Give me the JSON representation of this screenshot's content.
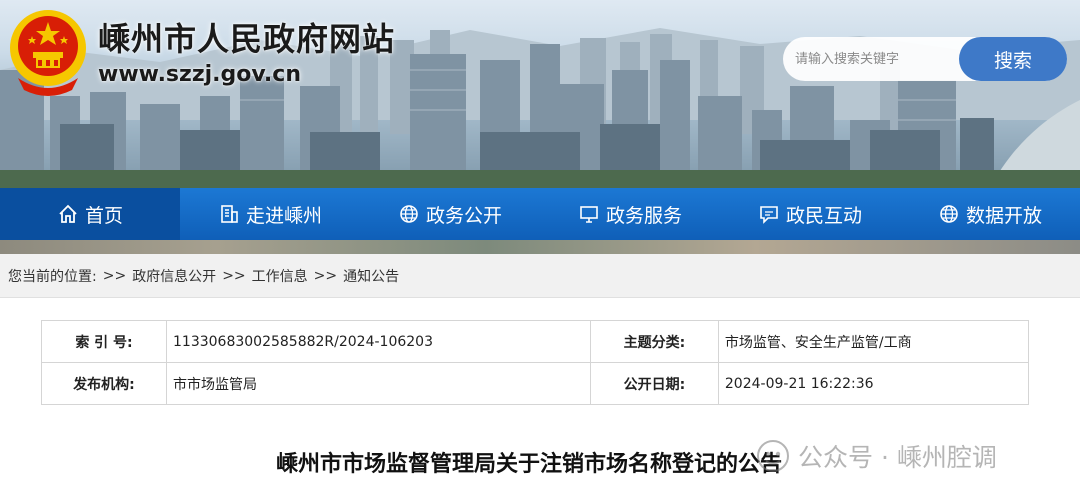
{
  "header": {
    "site_title": "嵊州市人民政府网站",
    "site_url": "www.szzj.gov.cn",
    "search_placeholder": "请输入搜索关键字",
    "search_label": "搜索"
  },
  "nav": {
    "items": [
      {
        "label": "首页",
        "icon": "home-icon"
      },
      {
        "label": "走进嵊州",
        "icon": "building-icon"
      },
      {
        "label": "政务公开",
        "icon": "globe-icon"
      },
      {
        "label": "政务服务",
        "icon": "monitor-icon"
      },
      {
        "label": "政民互动",
        "icon": "chat-icon"
      },
      {
        "label": "数据开放",
        "icon": "globe-icon"
      }
    ],
    "active_index": 0
  },
  "breadcrumb": {
    "prefix": "您当前的位置:",
    "separator": ">>",
    "items": [
      "政府信息公开",
      "工作信息",
      "通知公告"
    ]
  },
  "info": {
    "index_label": "索 引 号:",
    "index_value": "11330683002585882R/2024-106203",
    "category_label": "主题分类:",
    "category_value": "市场监管、安全生产监管/工商",
    "publisher_label": "发布机构:",
    "publisher_value": "市市场监管局",
    "date_label": "公开日期:",
    "date_value": "2024-09-21 16:22:36"
  },
  "article": {
    "title": "嵊州市市场监督管理局关于注销市场名称登记的公告"
  },
  "watermark": {
    "text": "公众号 · 嵊州腔调"
  },
  "colors": {
    "nav_blue": "#1469c6",
    "search_button": "#3e79c8",
    "emblem_red": "#d81e06",
    "emblem_gold": "#f6c700"
  }
}
